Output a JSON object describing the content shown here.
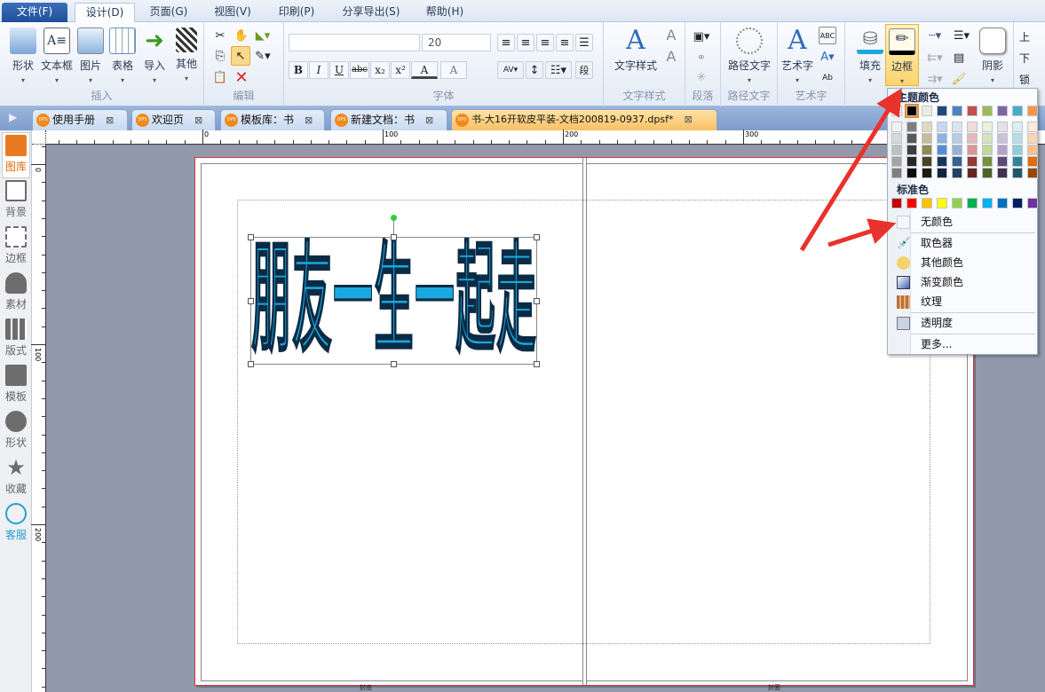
{
  "menubar": {
    "tabs": [
      "文件(F)",
      "设计(D)",
      "页面(G)",
      "视图(V)",
      "印刷(P)",
      "分享导出(S)",
      "帮助(H)"
    ],
    "active": "设计(D)"
  },
  "ribbon": {
    "insert": {
      "label": "插入",
      "items": [
        "形状",
        "文本框",
        "图片",
        "表格",
        "导入",
        "其他"
      ]
    },
    "edit": {
      "label": "编辑"
    },
    "font": {
      "label": "字体",
      "font_name": "",
      "font_size": "20",
      "buttons": [
        "B",
        "I",
        "U",
        "abc",
        "x₂",
        "x²",
        "A",
        "A"
      ]
    },
    "text_style": {
      "label": "文字样式",
      "button": "文字样式"
    },
    "paragraph": {
      "label": "段落",
      "button": "段"
    },
    "path_text": {
      "label": "路径文字",
      "button": "路径文字"
    },
    "art_text": {
      "label": "艺术字",
      "button": "艺术字"
    },
    "fill": {
      "button": "填充"
    },
    "border": {
      "button": "边框"
    },
    "shadow": {
      "button": "阴影"
    },
    "arrange": {
      "items": [
        "上",
        "下",
        "锁"
      ]
    }
  },
  "doc_tabs": [
    {
      "label": "使用手册"
    },
    {
      "label": "欢迎页"
    },
    {
      "label": "模板库：书"
    },
    {
      "label": "新建文档：书"
    },
    {
      "label": "书-大16开软皮平装-文档200819-0937.dpsf*",
      "active": true
    }
  ],
  "sidebar": {
    "items": [
      "图库",
      "背景",
      "边框",
      "素材",
      "版式",
      "模板",
      "形状",
      "收藏",
      "客服"
    ]
  },
  "rulers": {
    "top_labels": [
      "0",
      "100",
      "200",
      "300"
    ],
    "left_labels": [
      "0",
      "100",
      "200"
    ]
  },
  "canvas": {
    "art_text": "朋友一生一起走",
    "art_color": "#19a9e0",
    "page_labels": [
      "封底",
      "封面"
    ]
  },
  "color_menu": {
    "theme_title": "主题颜色",
    "theme_colors": [
      "#ffffff",
      "#000000",
      "#eeece1",
      "#1f497d",
      "#4f81bd",
      "#c0504d",
      "#9bbb59",
      "#8064a2",
      "#4bacc6",
      "#f79646"
    ],
    "theme_shades": [
      [
        "#f2f2f2",
        "#d8d8d8",
        "#bfbfbf",
        "#a5a5a5",
        "#7f7f7f"
      ],
      [
        "#7f7f7f",
        "#595959",
        "#3f3f3f",
        "#262626",
        "#0c0c0c"
      ],
      [
        "#ddd9c3",
        "#c4bd97",
        "#938953",
        "#494429",
        "#1d1b10"
      ],
      [
        "#c6d9f0",
        "#8db3e2",
        "#548dd4",
        "#17365d",
        "#0f243e"
      ],
      [
        "#dbe5f1",
        "#b8cce4",
        "#95b3d7",
        "#366092",
        "#244061"
      ],
      [
        "#f2dcdb",
        "#e5b9b7",
        "#d99694",
        "#953734",
        "#632423"
      ],
      [
        "#ebf1dd",
        "#d7e3bc",
        "#c3d69b",
        "#76923c",
        "#4f6128"
      ],
      [
        "#e5e0ec",
        "#ccc1d9",
        "#b2a2c7",
        "#5f497a",
        "#3f3151"
      ],
      [
        "#dbeef3",
        "#b7dde8",
        "#92cddc",
        "#31859b",
        "#205867"
      ],
      [
        "#fdeada",
        "#fbd5b5",
        "#fac08f",
        "#e36c09",
        "#974806"
      ]
    ],
    "standard_title": "标准色",
    "standard_colors": [
      "#c00000",
      "#ff0000",
      "#ffc000",
      "#ffff00",
      "#92d050",
      "#00b050",
      "#00b0f0",
      "#0070c0",
      "#002060",
      "#7030a0"
    ],
    "items": [
      "无颜色",
      "取色器",
      "其他颜色",
      "渐变颜色",
      "纹理",
      "透明度",
      "更多..."
    ]
  }
}
